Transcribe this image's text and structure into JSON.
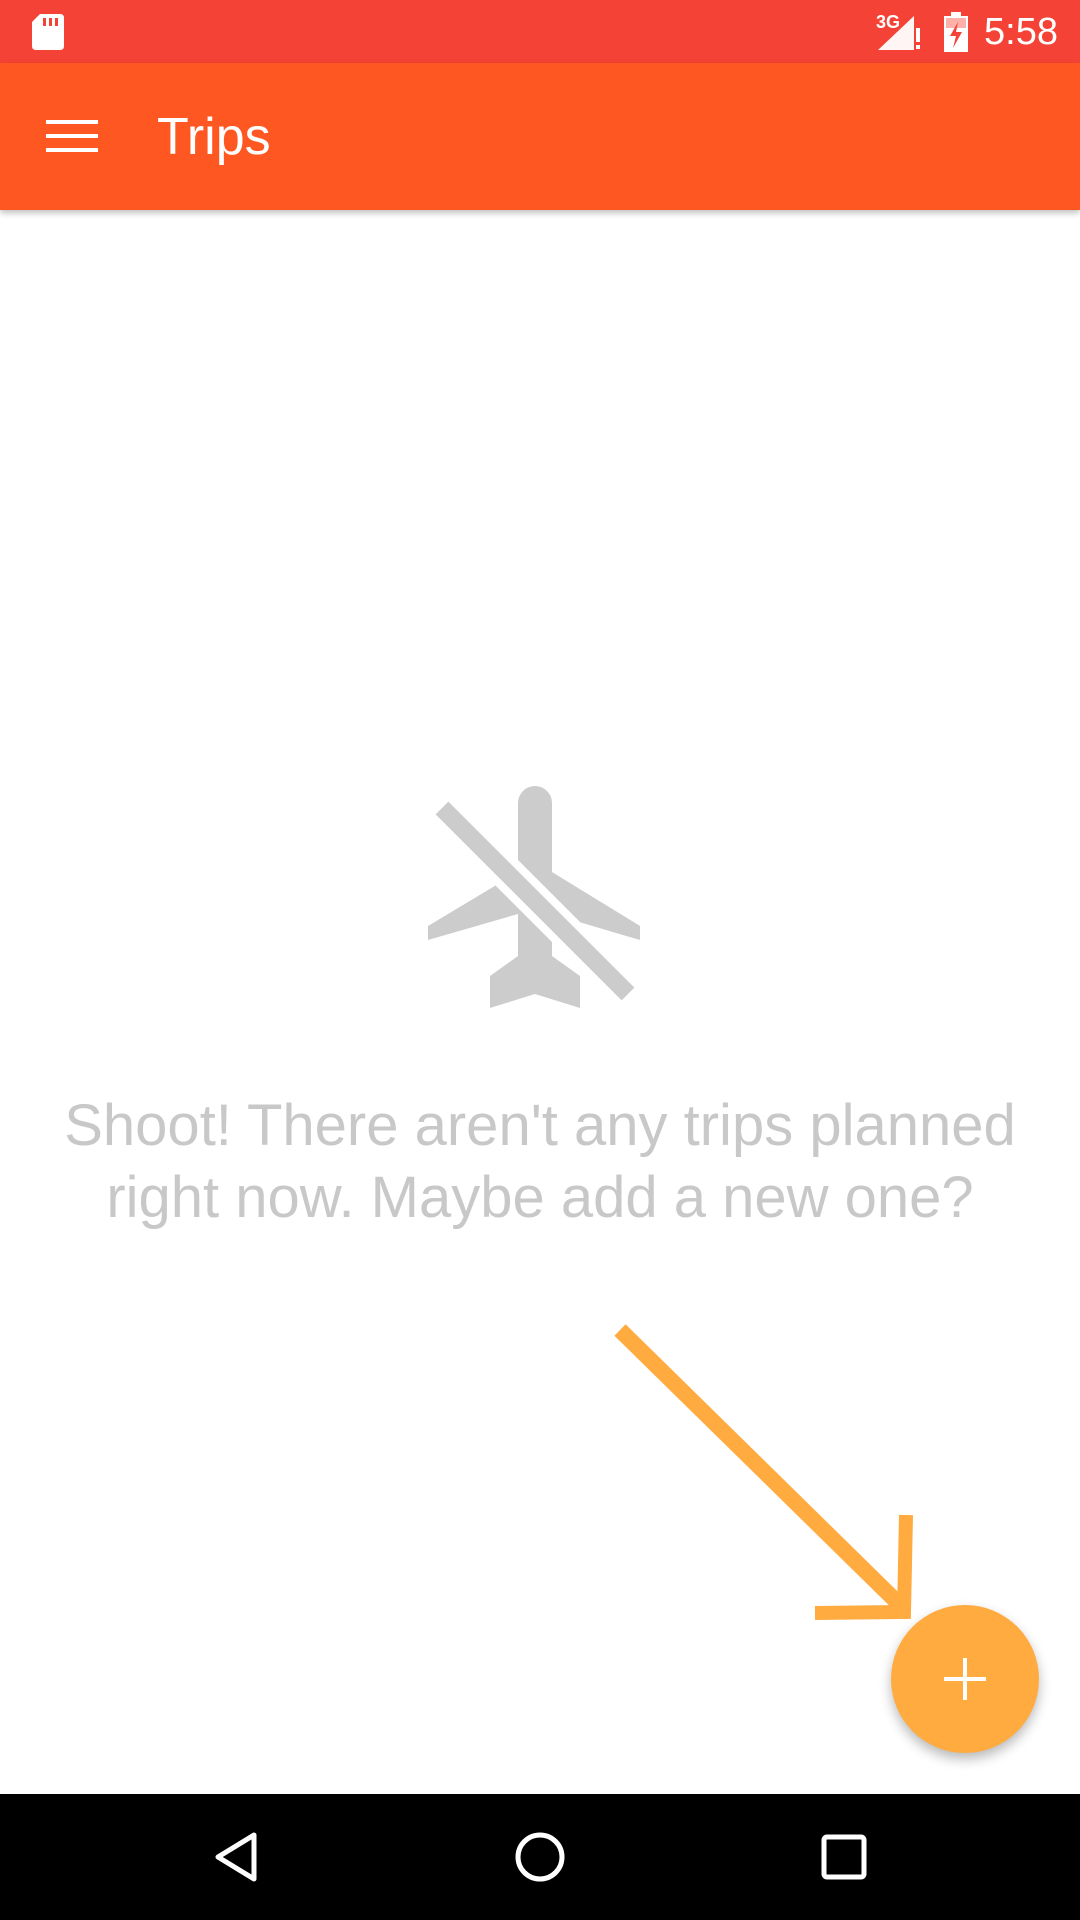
{
  "status_bar": {
    "time": "5:58",
    "network_label": "3G",
    "icons": [
      "sd-card-icon",
      "signal-alert-icon",
      "battery-charging-icon"
    ]
  },
  "app_bar": {
    "title": "Trips",
    "menu_icon": "hamburger-menu-icon"
  },
  "empty_state": {
    "icon": "airplane-off-icon",
    "message": "Shoot! There aren't any trips planned right now. Maybe add a new one?"
  },
  "hint": {
    "icon": "pointer-arrow-icon"
  },
  "fab": {
    "icon": "plus-icon"
  },
  "nav_bar": {
    "buttons": [
      "back-icon",
      "home-icon",
      "recents-icon"
    ]
  },
  "colors": {
    "status_bar": "#f44336",
    "app_bar": "#ff5722",
    "accent": "#ffab40",
    "empty_text": "#c8c8c8",
    "empty_icon": "#cccccc"
  }
}
